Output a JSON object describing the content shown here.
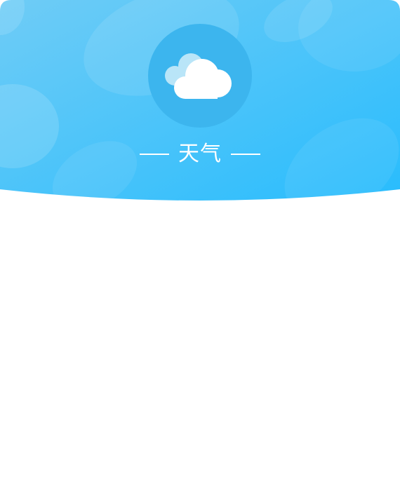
{
  "header": {
    "title": "天气",
    "icon": "cloud-icon",
    "colors": {
      "gradient_start": "#6fccf6",
      "gradient_end": "#28bcfd",
      "icon_circle": "#3cb5ee"
    }
  }
}
